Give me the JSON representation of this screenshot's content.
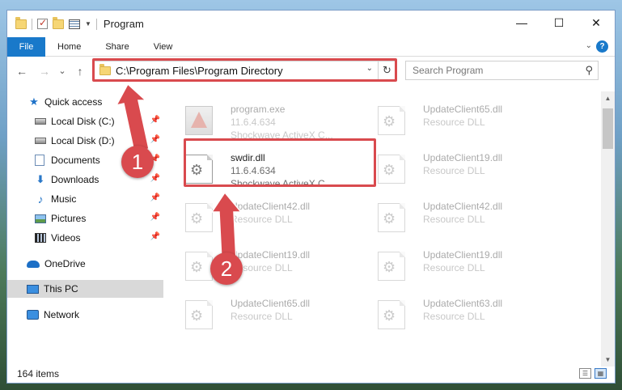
{
  "window": {
    "title": "Program",
    "controls": {
      "minimize": "—",
      "maximize": "☐",
      "close": "✕"
    }
  },
  "ribbon": {
    "file_tab": "File",
    "tabs": [
      "Home",
      "Share",
      "View"
    ],
    "help": "?"
  },
  "nav": {
    "back": "←",
    "forward": "→",
    "recent": "⌄",
    "up": "↑",
    "address": "C:\\Program Files\\Program Directory",
    "refresh": "↻",
    "search_placeholder": "Search Program",
    "search_icon": "search-icon"
  },
  "sidebar": {
    "items": [
      {
        "label": "Quick access",
        "icon": "star-icon"
      },
      {
        "label": "Local Disk (C:)",
        "icon": "disk-icon",
        "pinned": true
      },
      {
        "label": "Local Disk (D:)",
        "icon": "disk-icon",
        "pinned": true
      },
      {
        "label": "Documents",
        "icon": "documents-icon",
        "pinned": true
      },
      {
        "label": "Downloads",
        "icon": "download-icon",
        "pinned": true
      },
      {
        "label": "Music",
        "icon": "music-icon",
        "pinned": true
      },
      {
        "label": "Pictures",
        "icon": "pictures-icon",
        "pinned": true
      },
      {
        "label": "Videos",
        "icon": "videos-icon",
        "pinned": true
      },
      {
        "label": "OneDrive",
        "icon": "cloud-icon"
      },
      {
        "label": "This PC",
        "icon": "computer-icon",
        "selected": true
      },
      {
        "label": "Network",
        "icon": "network-icon"
      }
    ],
    "pin_glyph": "📌"
  },
  "files": [
    {
      "name": "program.exe",
      "line2": "11.6.4.634",
      "line3": "Shockwave ActiveX C...",
      "icon": "exe-icon",
      "faded": true
    },
    {
      "name": "UpdateClient65.dll",
      "line2": "Resource DLL",
      "icon": "dll-icon",
      "faded": true
    },
    {
      "name": "swdir.dll",
      "line2": "11.6.4.634",
      "line3": "Shockwave ActiveX C...",
      "icon": "dll-icon",
      "faded": false
    },
    {
      "name": "UpdateClient19.dll",
      "line2": "Resource DLL",
      "icon": "dll-icon",
      "faded": true
    },
    {
      "name": "UpdateClient42.dll",
      "line2": "Resource DLL",
      "icon": "dll-icon",
      "faded": true
    },
    {
      "name": "UpdateClient42.dll",
      "line2": "Resource DLL",
      "icon": "dll-icon",
      "faded": true
    },
    {
      "name": "UpdateClient19.dll",
      "line2": "Resource DLL",
      "icon": "dll-icon",
      "faded": true
    },
    {
      "name": "UpdateClient19.dll",
      "line2": "Resource DLL",
      "icon": "dll-icon",
      "faded": true
    },
    {
      "name": "UpdateClient65.dll",
      "line2": "Resource DLL",
      "icon": "dll-icon",
      "faded": true
    },
    {
      "name": "UpdateClient63.dll",
      "line2": "Resource DLL",
      "icon": "dll-icon",
      "faded": true
    }
  ],
  "status": {
    "count": "164 items"
  },
  "callouts": {
    "one": "1",
    "two": "2",
    "color": "#d94a4e"
  }
}
